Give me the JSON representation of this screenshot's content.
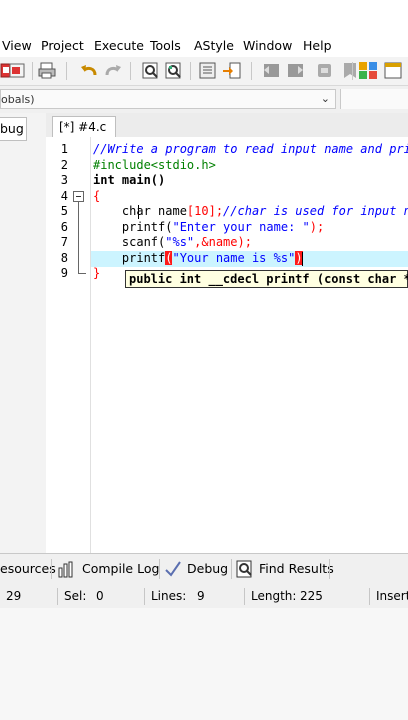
{
  "menu": [
    "View",
    "Project",
    "Execute",
    "Tools",
    "AStyle",
    "Window",
    "Help"
  ],
  "globals_combo": "obals)",
  "left_tab": "bug",
  "file_tab": "[*] #4.c",
  "editor": {
    "line_numbers": [
      "1",
      "2",
      "3",
      "4",
      "5",
      "6",
      "7",
      "8",
      "9"
    ],
    "line1": "//Write a program to read input name and pri",
    "line2": "#include<stdio.h>",
    "line3": "int main()",
    "line4": "{",
    "line5_a": "    char name",
    "line5_b": "[10];",
    "line5_c": "//char is used for input n",
    "line6_a": "    printf(",
    "line6_b": "\"Enter your name: \"",
    "line6_c": ");",
    "line7_a": "    scanf(",
    "line7_b": "\"%s\"",
    "line7_c": ",&name);",
    "line8_a": "    printf",
    "line8_b": "(",
    "line8_c": "\"Your name is %s\"",
    "line8_d": ")",
    "line9": "}",
    "tooltip": "public int __cdecl printf (const char *"
  },
  "bottom_tabs": {
    "resources": "esources",
    "compile_log": "Compile Log",
    "debug": "Debug",
    "find_results": "Find Results"
  },
  "status": {
    "col": "29",
    "sel_label": "Sel:",
    "sel_value": "0",
    "lines_label": "Lines:",
    "lines_value": "9",
    "length_label": "Length:",
    "length_value": "225",
    "mode": "Insert"
  },
  "colors": {
    "current_line": "#ccf4ff",
    "comment": "#0000ff",
    "preprocessor": "#008000",
    "brace_match": "#ff1a1a"
  }
}
